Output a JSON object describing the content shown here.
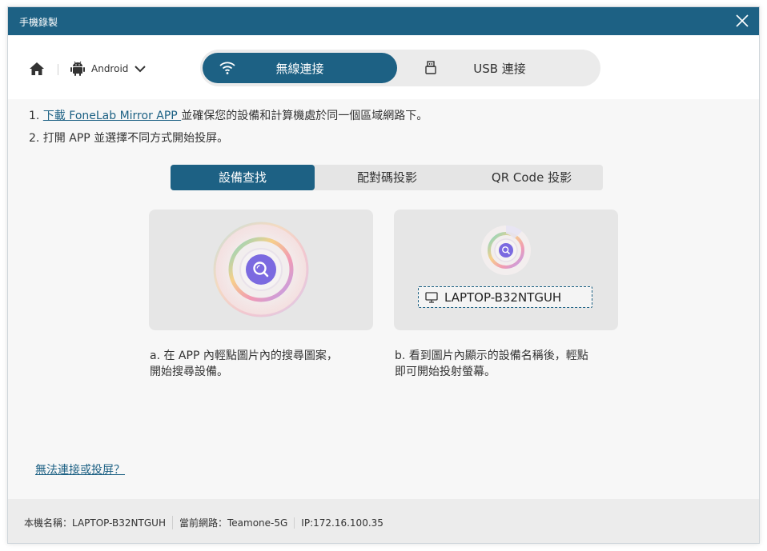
{
  "window": {
    "title": "手機錄製"
  },
  "toolbar": {
    "device_os": "Android",
    "connection_tabs": [
      {
        "label": "無線連接",
        "icon": "wifi-icon",
        "active": true
      },
      {
        "label": "USB 連接",
        "icon": "usb-icon",
        "active": false
      }
    ]
  },
  "instructions": {
    "step1_number": "1.",
    "step1_link": "下載 FoneLab Mirror APP ",
    "step1_rest": "並確保您的設備和計算機處於同一個區域網路下。",
    "step2": "2. 打開 APP 並選擇不同方式開始投屏。"
  },
  "mode_tabs": [
    {
      "label": "設備查找",
      "active": true
    },
    {
      "label": "配對碼投影",
      "active": false
    },
    {
      "label": "QR Code 投影",
      "active": false
    }
  ],
  "cards": {
    "a": {
      "caption_line1": "a. 在 APP 內輕點圖片內的搜尋圖案，",
      "caption_line2": "開始搜尋設備。"
    },
    "b": {
      "device_name": "LAPTOP-B32NTGUH",
      "caption_line1": "b. 看到圖片內顯示的設備名稱後，輕點",
      "caption_line2": "即可開始投射螢幕。"
    }
  },
  "help_link": "無法連接或投屏？",
  "status_bar": {
    "host": "本機名稱：LAPTOP-B32NTGUH",
    "network": "當前網路：Teamone-5G",
    "ip": "IP:172.16.100.35"
  },
  "colors": {
    "accent": "#1d6184",
    "card_bg": "#e6e6e6",
    "status_bg": "#ececec"
  }
}
